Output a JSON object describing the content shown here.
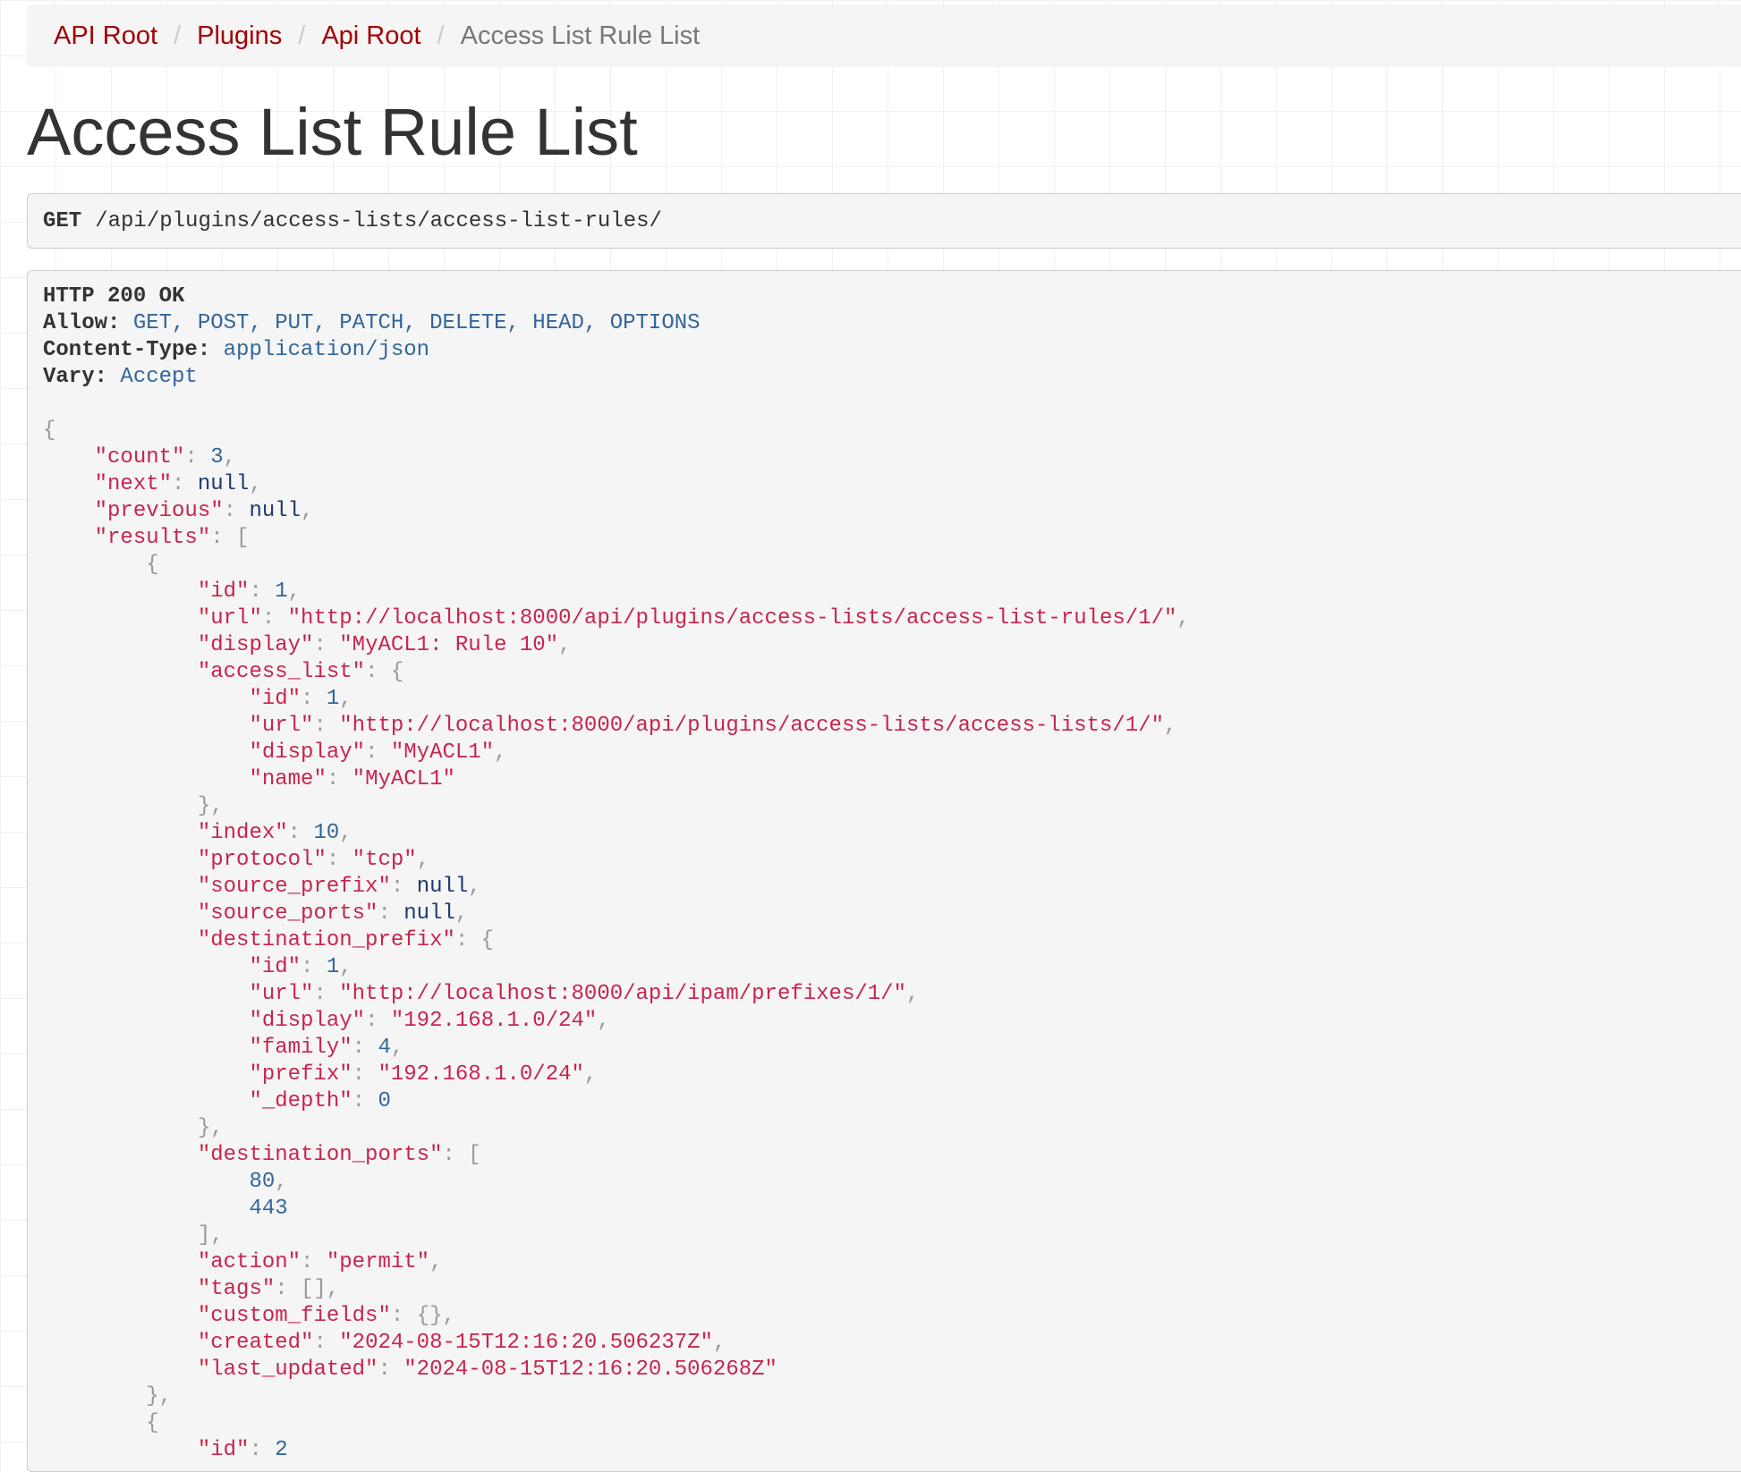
{
  "breadcrumb": {
    "items": [
      {
        "label": "API Root"
      },
      {
        "label": "Plugins"
      },
      {
        "label": "Api Root"
      }
    ],
    "current": "Access List Rule List",
    "separator": "/"
  },
  "page_title": "Access List Rule List",
  "request": {
    "method": "GET",
    "path": "/api/plugins/access-lists/access-list-rules/"
  },
  "response": {
    "status": "HTTP 200 OK",
    "headers": [
      {
        "key": "Allow:",
        "value": "GET, POST, PUT, PATCH, DELETE, HEAD, OPTIONS"
      },
      {
        "key": "Content-Type:",
        "value": "application/json"
      },
      {
        "key": "Vary:",
        "value": "Accept"
      }
    ],
    "body_lines": [
      [
        {
          "t": "p",
          "v": "{"
        }
      ],
      [
        {
          "t": "i",
          "v": "    "
        },
        {
          "t": "k",
          "v": "\"count\""
        },
        {
          "t": "p",
          "v": ": "
        },
        {
          "t": "n",
          "v": "3"
        },
        {
          "t": "p",
          "v": ","
        }
      ],
      [
        {
          "t": "i",
          "v": "    "
        },
        {
          "t": "k",
          "v": "\"next\""
        },
        {
          "t": "p",
          "v": ": "
        },
        {
          "t": "l",
          "v": "null"
        },
        {
          "t": "p",
          "v": ","
        }
      ],
      [
        {
          "t": "i",
          "v": "    "
        },
        {
          "t": "k",
          "v": "\"previous\""
        },
        {
          "t": "p",
          "v": ": "
        },
        {
          "t": "l",
          "v": "null"
        },
        {
          "t": "p",
          "v": ","
        }
      ],
      [
        {
          "t": "i",
          "v": "    "
        },
        {
          "t": "k",
          "v": "\"results\""
        },
        {
          "t": "p",
          "v": ": ["
        }
      ],
      [
        {
          "t": "i",
          "v": "        "
        },
        {
          "t": "p",
          "v": "{"
        }
      ],
      [
        {
          "t": "i",
          "v": "            "
        },
        {
          "t": "k",
          "v": "\"id\""
        },
        {
          "t": "p",
          "v": ": "
        },
        {
          "t": "n",
          "v": "1"
        },
        {
          "t": "p",
          "v": ","
        }
      ],
      [
        {
          "t": "i",
          "v": "            "
        },
        {
          "t": "k",
          "v": "\"url\""
        },
        {
          "t": "p",
          "v": ": "
        },
        {
          "t": "s",
          "v": "\"http://localhost:8000/api/plugins/access-lists/access-list-rules/1/\""
        },
        {
          "t": "p",
          "v": ","
        }
      ],
      [
        {
          "t": "i",
          "v": "            "
        },
        {
          "t": "k",
          "v": "\"display\""
        },
        {
          "t": "p",
          "v": ": "
        },
        {
          "t": "s",
          "v": "\"MyACL1: Rule 10\""
        },
        {
          "t": "p",
          "v": ","
        }
      ],
      [
        {
          "t": "i",
          "v": "            "
        },
        {
          "t": "k",
          "v": "\"access_list\""
        },
        {
          "t": "p",
          "v": ": {"
        }
      ],
      [
        {
          "t": "i",
          "v": "                "
        },
        {
          "t": "k",
          "v": "\"id\""
        },
        {
          "t": "p",
          "v": ": "
        },
        {
          "t": "n",
          "v": "1"
        },
        {
          "t": "p",
          "v": ","
        }
      ],
      [
        {
          "t": "i",
          "v": "                "
        },
        {
          "t": "k",
          "v": "\"url\""
        },
        {
          "t": "p",
          "v": ": "
        },
        {
          "t": "s",
          "v": "\"http://localhost:8000/api/plugins/access-lists/access-lists/1/\""
        },
        {
          "t": "p",
          "v": ","
        }
      ],
      [
        {
          "t": "i",
          "v": "                "
        },
        {
          "t": "k",
          "v": "\"display\""
        },
        {
          "t": "p",
          "v": ": "
        },
        {
          "t": "s",
          "v": "\"MyACL1\""
        },
        {
          "t": "p",
          "v": ","
        }
      ],
      [
        {
          "t": "i",
          "v": "                "
        },
        {
          "t": "k",
          "v": "\"name\""
        },
        {
          "t": "p",
          "v": ": "
        },
        {
          "t": "s",
          "v": "\"MyACL1\""
        }
      ],
      [
        {
          "t": "i",
          "v": "            "
        },
        {
          "t": "p",
          "v": "},"
        }
      ],
      [
        {
          "t": "i",
          "v": "            "
        },
        {
          "t": "k",
          "v": "\"index\""
        },
        {
          "t": "p",
          "v": ": "
        },
        {
          "t": "n",
          "v": "10"
        },
        {
          "t": "p",
          "v": ","
        }
      ],
      [
        {
          "t": "i",
          "v": "            "
        },
        {
          "t": "k",
          "v": "\"protocol\""
        },
        {
          "t": "p",
          "v": ": "
        },
        {
          "t": "s",
          "v": "\"tcp\""
        },
        {
          "t": "p",
          "v": ","
        }
      ],
      [
        {
          "t": "i",
          "v": "            "
        },
        {
          "t": "k",
          "v": "\"source_prefix\""
        },
        {
          "t": "p",
          "v": ": "
        },
        {
          "t": "l",
          "v": "null"
        },
        {
          "t": "p",
          "v": ","
        }
      ],
      [
        {
          "t": "i",
          "v": "            "
        },
        {
          "t": "k",
          "v": "\"source_ports\""
        },
        {
          "t": "p",
          "v": ": "
        },
        {
          "t": "l",
          "v": "null"
        },
        {
          "t": "p",
          "v": ","
        }
      ],
      [
        {
          "t": "i",
          "v": "            "
        },
        {
          "t": "k",
          "v": "\"destination_prefix\""
        },
        {
          "t": "p",
          "v": ": {"
        }
      ],
      [
        {
          "t": "i",
          "v": "                "
        },
        {
          "t": "k",
          "v": "\"id\""
        },
        {
          "t": "p",
          "v": ": "
        },
        {
          "t": "n",
          "v": "1"
        },
        {
          "t": "p",
          "v": ","
        }
      ],
      [
        {
          "t": "i",
          "v": "                "
        },
        {
          "t": "k",
          "v": "\"url\""
        },
        {
          "t": "p",
          "v": ": "
        },
        {
          "t": "s",
          "v": "\"http://localhost:8000/api/ipam/prefixes/1/\""
        },
        {
          "t": "p",
          "v": ","
        }
      ],
      [
        {
          "t": "i",
          "v": "                "
        },
        {
          "t": "k",
          "v": "\"display\""
        },
        {
          "t": "p",
          "v": ": "
        },
        {
          "t": "s",
          "v": "\"192.168.1.0/24\""
        },
        {
          "t": "p",
          "v": ","
        }
      ],
      [
        {
          "t": "i",
          "v": "                "
        },
        {
          "t": "k",
          "v": "\"family\""
        },
        {
          "t": "p",
          "v": ": "
        },
        {
          "t": "n",
          "v": "4"
        },
        {
          "t": "p",
          "v": ","
        }
      ],
      [
        {
          "t": "i",
          "v": "                "
        },
        {
          "t": "k",
          "v": "\"prefix\""
        },
        {
          "t": "p",
          "v": ": "
        },
        {
          "t": "s",
          "v": "\"192.168.1.0/24\""
        },
        {
          "t": "p",
          "v": ","
        }
      ],
      [
        {
          "t": "i",
          "v": "                "
        },
        {
          "t": "k",
          "v": "\"_depth\""
        },
        {
          "t": "p",
          "v": ": "
        },
        {
          "t": "n",
          "v": "0"
        }
      ],
      [
        {
          "t": "i",
          "v": "            "
        },
        {
          "t": "p",
          "v": "},"
        }
      ],
      [
        {
          "t": "i",
          "v": "            "
        },
        {
          "t": "k",
          "v": "\"destination_ports\""
        },
        {
          "t": "p",
          "v": ": ["
        }
      ],
      [
        {
          "t": "i",
          "v": "                "
        },
        {
          "t": "n",
          "v": "80"
        },
        {
          "t": "p",
          "v": ","
        }
      ],
      [
        {
          "t": "i",
          "v": "                "
        },
        {
          "t": "n",
          "v": "443"
        }
      ],
      [
        {
          "t": "i",
          "v": "            "
        },
        {
          "t": "p",
          "v": "],"
        }
      ],
      [
        {
          "t": "i",
          "v": "            "
        },
        {
          "t": "k",
          "v": "\"action\""
        },
        {
          "t": "p",
          "v": ": "
        },
        {
          "t": "s",
          "v": "\"permit\""
        },
        {
          "t": "p",
          "v": ","
        }
      ],
      [
        {
          "t": "i",
          "v": "            "
        },
        {
          "t": "k",
          "v": "\"tags\""
        },
        {
          "t": "p",
          "v": ": [],"
        }
      ],
      [
        {
          "t": "i",
          "v": "            "
        },
        {
          "t": "k",
          "v": "\"custom_fields\""
        },
        {
          "t": "p",
          "v": ": {},"
        }
      ],
      [
        {
          "t": "i",
          "v": "            "
        },
        {
          "t": "k",
          "v": "\"created\""
        },
        {
          "t": "p",
          "v": ": "
        },
        {
          "t": "s",
          "v": "\"2024-08-15T12:16:20.506237Z\""
        },
        {
          "t": "p",
          "v": ","
        }
      ],
      [
        {
          "t": "i",
          "v": "            "
        },
        {
          "t": "k",
          "v": "\"last_updated\""
        },
        {
          "t": "p",
          "v": ": "
        },
        {
          "t": "s",
          "v": "\"2024-08-15T12:16:20.506268Z\""
        }
      ],
      [
        {
          "t": "i",
          "v": "        "
        },
        {
          "t": "p",
          "v": "},"
        }
      ],
      [
        {
          "t": "i",
          "v": "        "
        },
        {
          "t": "p",
          "v": "{"
        }
      ],
      [
        {
          "t": "i",
          "v": "            "
        },
        {
          "t": "k",
          "v": "\"id\""
        },
        {
          "t": "p",
          "v": ": "
        },
        {
          "t": "n",
          "v": "2"
        }
      ]
    ]
  },
  "colors": {
    "link": "#a30000",
    "json_key": "#c7254e",
    "json_string": "#c7254e",
    "json_number": "#336699",
    "json_null": "#1f3a6e",
    "json_punct": "#999999",
    "header_value": "#336699"
  }
}
